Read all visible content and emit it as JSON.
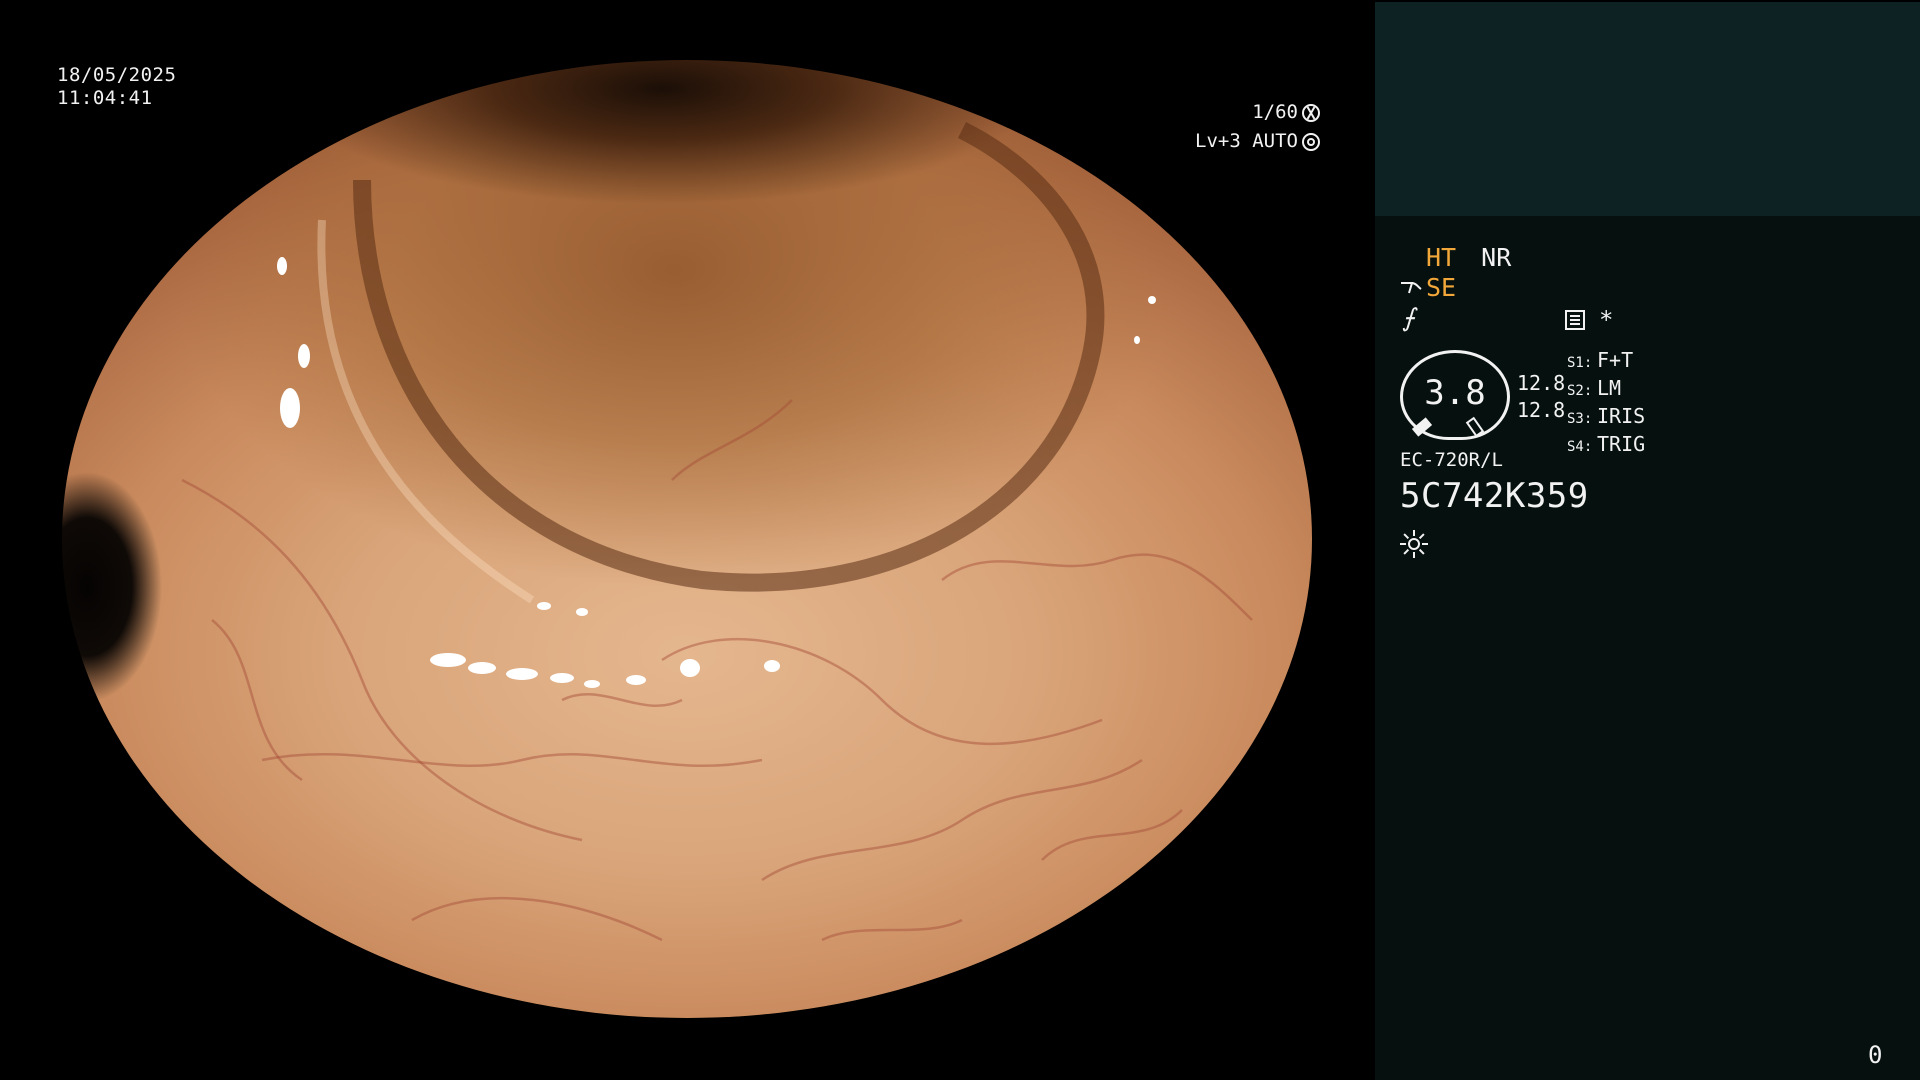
{
  "overlay": {
    "date": "18/05/2025",
    "time": "11:04:41",
    "shutter": "1/60",
    "level": "Lv+3 AUTO"
  },
  "panel": {
    "mode_ht": "HT",
    "mode_nr": "NR",
    "mode_se": "SE",
    "function_symbol": "⨍",
    "asterisk": "*",
    "gauge_value": "3.8",
    "gauge_num1": "12.8",
    "gauge_num2": "12.8",
    "switches": [
      {
        "label": "S1:",
        "value": "F+T"
      },
      {
        "label": "S2:",
        "value": "LM"
      },
      {
        "label": "S3:",
        "value": "IRIS"
      },
      {
        "label": "S4:",
        "value": "TRIG"
      }
    ],
    "scope_model": "EC-720R/L",
    "scope_serial": "5C742K359",
    "counter": "0"
  },
  "icons": {
    "shutter": "shutter-icon",
    "iris": "iris-icon",
    "record": "record-icon",
    "light": "light-icon",
    "scope": "scope-icon"
  },
  "colors": {
    "accent_orange": "#f2a73a",
    "panel_top": "#0d2223",
    "panel_bottom": "#06110f"
  }
}
